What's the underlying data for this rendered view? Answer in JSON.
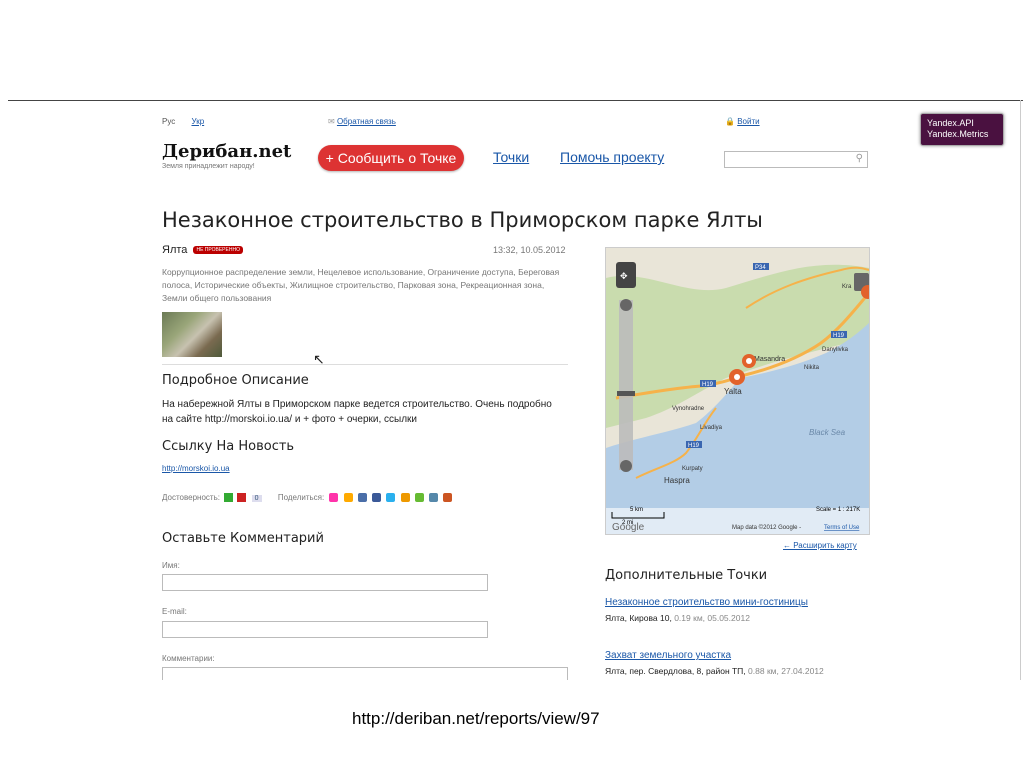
{
  "header": {
    "lang_ru": "Рус",
    "lang_ua": "Укр",
    "feedback": "Обратная связь",
    "login": "Войти",
    "logo": "Дерибан.net",
    "tagline": "Земля принадлежит народу!",
    "report_button": "+ Сообщить о Точке",
    "nav_points": "Точки",
    "nav_help": "Помочь проекту",
    "search_placeholder": ""
  },
  "tooltip": {
    "line1": "Yandex.API",
    "line2": "Yandex.Metrics"
  },
  "article": {
    "title": "Незаконное строительство в Приморском парке Ялты",
    "city": "Ялта",
    "badge": "НЕ ПРОВЕРЕННО",
    "datetime": "13:32, 10.05.2012",
    "tags": "Коррупционное распределение земли, Нецелевое использование, Ограничение доступа, Береговая полоса, Исторические объекты, Жилищное строительство, Парковая зона, Рекреационная зона, Земли общего пользования",
    "desc_heading": "Подробное Описание",
    "description": "На набережной Ялты в Приморском парке ведется строительство. Очень подробно на сайте http://morskoi.io.ua/ и + фото + очерки, ссылки",
    "news_heading": "Ссылку На Новость",
    "news_link": "http://morskoi.io.ua",
    "trust_label": "Достоверность:",
    "trust_count": "0",
    "share_label": "Поделиться:"
  },
  "comment_form": {
    "heading": "Оставьте Комментарий",
    "name_label": "Имя:",
    "email_label": "E-mail:",
    "comment_label": "Комментарии:"
  },
  "map": {
    "labels": {
      "yalta": "Yalta",
      "vynohradne": "Vynohradne",
      "livadiya": "Livadiya",
      "kurpaty": "Kurpaty",
      "haspra": "Haspra",
      "black_sea": "Black Sea",
      "nikita": "Nikita",
      "danylivka": "Danylivka",
      "masandra": "Masandra",
      "krasnokamianka": "Kra",
      "road_p34": "P34",
      "road_h19a": "H19",
      "road_h19b": "H19",
      "road_h19c": "H19",
      "scale_km": "5 km",
      "scale_mi": "2 mi",
      "scale_ratio": "Scale = 1 : 217K",
      "attribution": "Map data ©2012 Google -",
      "terms": "Terms of Use",
      "google": "Google"
    },
    "colors": {
      "sea": "#b3cde6",
      "land": "#e9e5d8",
      "green": "#c9dcae",
      "road": "#f6b24a",
      "marker": "#e2622b"
    },
    "zoom_fraction": 0.55
  },
  "sidebar": {
    "expand_map": "← Расширить карту",
    "more_heading": "Дополнительные Точки",
    "points": [
      {
        "title": "Незаконное строительство мини-гостиницы",
        "place": "Ялта, Кирова 10,",
        "meta": "0.19 км, 05.05.2012"
      },
      {
        "title": "Захват земельного участка",
        "place": "Ялта, пер. Свердлова, 8, район ТП,",
        "meta": "0.88 км, 27.04.2012"
      }
    ]
  },
  "footer": {
    "url": "http://deriban.net/reports/view/97"
  }
}
